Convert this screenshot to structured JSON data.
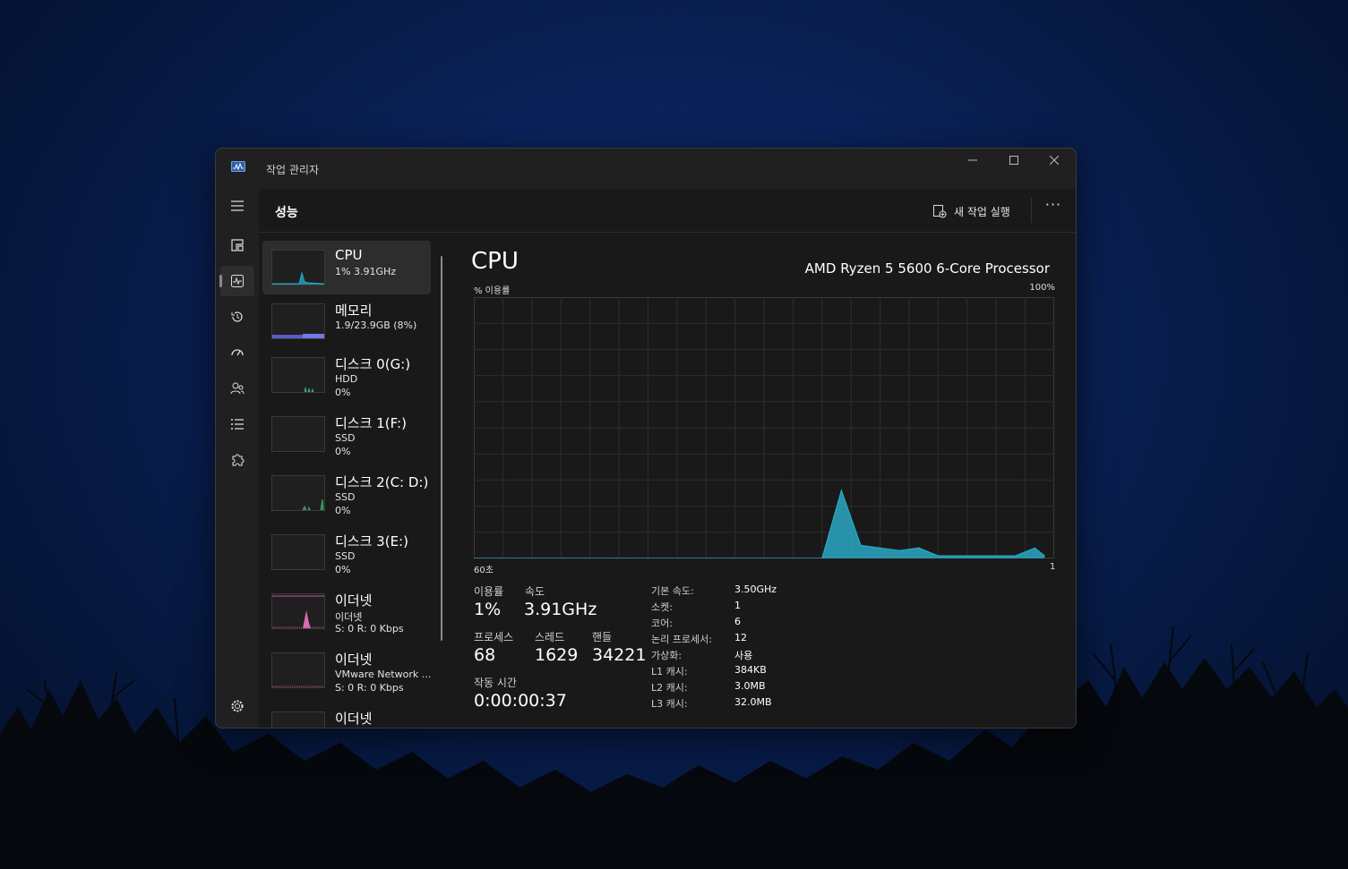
{
  "window": {
    "title": "작업 관리자"
  },
  "header": {
    "title": "성능",
    "new_task_label": "새 작업 실행",
    "more_label": "···"
  },
  "nav": {
    "items": [
      "menu-icon",
      "processes-icon",
      "performance-icon",
      "app-history-icon",
      "startup-apps-icon",
      "users-icon",
      "details-icon",
      "services-icon",
      "settings-icon"
    ]
  },
  "devices": [
    {
      "name": "CPU",
      "sub1": "1% 3.91GHz",
      "sub2": ""
    },
    {
      "name": "메모리",
      "sub1": "1.9/23.9GB (8%)",
      "sub2": ""
    },
    {
      "name": "디스크 0(G:)",
      "sub1": "HDD",
      "sub2": "0%"
    },
    {
      "name": "디스크 1(F:)",
      "sub1": "SSD",
      "sub2": "0%"
    },
    {
      "name": "디스크 2(C: D:)",
      "sub1": "SSD",
      "sub2": "0%"
    },
    {
      "name": "디스크 3(E:)",
      "sub1": "SSD",
      "sub2": "0%"
    },
    {
      "name": "이더넷",
      "sub1": "이더넷",
      "sub2": "S: 0 R: 0 Kbps"
    },
    {
      "name": "이더넷",
      "sub1": "VMware Network ...",
      "sub2": "S: 0 R: 0 Kbps"
    },
    {
      "name": "이더넷",
      "sub1": "",
      "sub2": ""
    }
  ],
  "cpu": {
    "title": "CPU",
    "model": "AMD Ryzen 5 5600 6-Core Processor",
    "y_label": "% 이용률",
    "y_max": "100%",
    "x_left": "60초",
    "x_right": "1"
  },
  "chart_data": {
    "type": "area",
    "x": [
      60,
      58,
      56,
      54,
      52,
      50,
      48,
      46,
      44,
      42,
      40,
      38,
      36,
      34,
      32,
      30,
      28,
      26,
      24,
      22,
      20,
      18,
      16,
      14,
      12,
      10,
      8,
      6,
      4,
      2,
      1
    ],
    "values": [
      0,
      0,
      0,
      0,
      0,
      0,
      0,
      0,
      0,
      0,
      0,
      0,
      0,
      0,
      0,
      0,
      0,
      0,
      0,
      26,
      5,
      4,
      3,
      4,
      1,
      1,
      1,
      1,
      1,
      4,
      1
    ],
    "ylim": [
      0,
      100
    ],
    "xlim": [
      60,
      0
    ],
    "grid": true,
    "color": "#2aa8c4"
  },
  "stats": {
    "util_label": "이용률",
    "util_value": "1%",
    "speed_label": "속도",
    "speed_value": "3.91GHz",
    "proc_label": "프로세스",
    "proc_value": "68",
    "thread_label": "스레드",
    "thread_value": "1629",
    "handle_label": "핸들",
    "handle_value": "34221",
    "uptime_label": "작동 시간",
    "uptime_value": "0:00:00:37"
  },
  "info": [
    {
      "k": "기본 속도:",
      "v": "3.50GHz"
    },
    {
      "k": "소켓:",
      "v": "1"
    },
    {
      "k": "코어:",
      "v": "6"
    },
    {
      "k": "논리 프로세서:",
      "v": "12"
    },
    {
      "k": "가상화:",
      "v": "사용"
    },
    {
      "k": "L1 캐시:",
      "v": "384KB"
    },
    {
      "k": "L2 캐시:",
      "v": "3.0MB"
    },
    {
      "k": "L3 캐시:",
      "v": "32.0MB"
    }
  ]
}
